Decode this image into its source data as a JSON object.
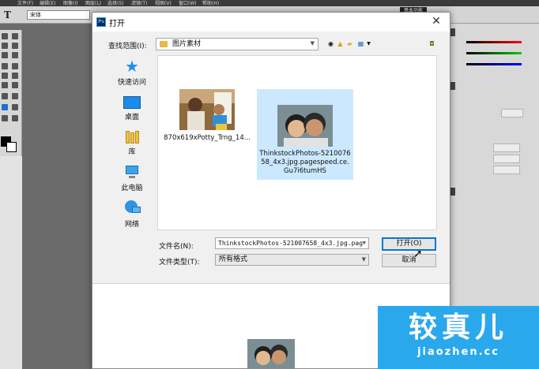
{
  "ps": {
    "menu": [
      "文件(F)",
      "编辑(E)",
      "图像(I)",
      "图层(L)",
      "选择(S)",
      "滤镜(T)",
      "视图(V)",
      "窗口(W)",
      "帮助(H)"
    ],
    "font_value": "宋体",
    "workspace_label": "基本功能"
  },
  "dialog": {
    "title": "打开",
    "close_glyph": "✕",
    "look_in_label": "查找范围(I):",
    "look_in_value": "图片素材",
    "places": [
      {
        "label": "快速访问"
      },
      {
        "label": "桌面"
      },
      {
        "label": "库"
      },
      {
        "label": "此电脑"
      },
      {
        "label": "网络"
      }
    ],
    "files": [
      {
        "name": "870x619xPotty_Trng_14...",
        "selected": false
      },
      {
        "name": "ThinkstockPhotos-521007658_4x3.jpg.pagespeed.ce.Gu7i6tumHS",
        "selected": true
      }
    ],
    "filename_label": "文件名(N):",
    "filename_value": "ThinkstockPhotos-521007658_4x3.jpg.pag",
    "filetype_label": "文件类型(T):",
    "filetype_value": "所有格式",
    "open_button": "打开(O)",
    "cancel_button": "取消"
  },
  "watermark": {
    "title": "较真儿",
    "url": "jiaozhen.cc"
  },
  "colors": {
    "accent": "#0078d7",
    "selection": "#cce8ff",
    "watermark": "#2aa8ec"
  }
}
